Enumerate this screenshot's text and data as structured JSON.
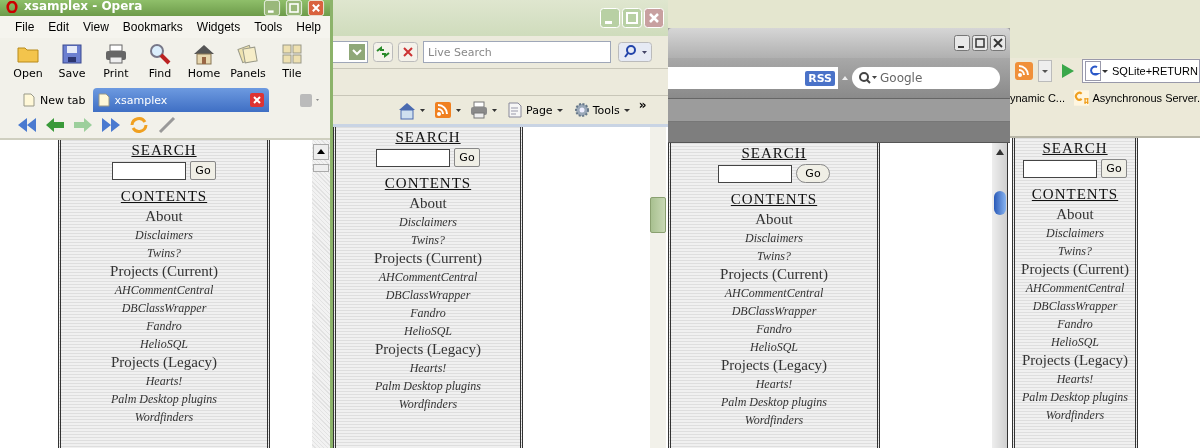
{
  "windows": [
    {
      "kind": "opera",
      "title": "xsamplex - Opera",
      "menu": [
        "File",
        "Edit",
        "View",
        "Bookmarks",
        "Widgets",
        "Tools",
        "Help"
      ],
      "toolbar": [
        {
          "label": "Open"
        },
        {
          "label": "Save"
        },
        {
          "label": "Print"
        },
        {
          "label": "Find"
        },
        {
          "label": "Home"
        },
        {
          "label": "Panels"
        },
        {
          "label": "Tile"
        }
      ],
      "tabs": [
        {
          "label": "New tab",
          "selected": false
        },
        {
          "label": "xsamplex",
          "selected": true
        }
      ],
      "page": {
        "search_heading": "SEARCH",
        "go": "Go",
        "contents_heading": "CONTENTS",
        "items": [
          {
            "text": "About",
            "kind": "heading"
          },
          {
            "text": "Disclaimers",
            "kind": "link"
          },
          {
            "text": "Twins?",
            "kind": "link"
          },
          {
            "text": "Projects (Current)",
            "kind": "heading"
          },
          {
            "text": "AHCommentCentral",
            "kind": "link"
          },
          {
            "text": "DBClassWrapper",
            "kind": "link"
          },
          {
            "text": "Fandro",
            "kind": "link"
          },
          {
            "text": "HelioSQL",
            "kind": "link"
          },
          {
            "text": "Projects (Legacy)",
            "kind": "heading"
          },
          {
            "text": "Hearts!",
            "kind": "link"
          },
          {
            "text": "Palm Desktop plugins",
            "kind": "link"
          },
          {
            "text": "Wordfinders",
            "kind": "link"
          }
        ]
      }
    },
    {
      "kind": "ie",
      "search_placeholder": "Live Search",
      "commands": [
        {
          "label": "Page"
        },
        {
          "label": "Tools"
        }
      ],
      "overflow": "»",
      "page": {
        "search_heading": "SEARCH",
        "go": "Go",
        "contents_heading": "CONTENTS",
        "items": [
          {
            "text": "About",
            "kind": "heading"
          },
          {
            "text": "Disclaimers",
            "kind": "link"
          },
          {
            "text": "Twins?",
            "kind": "link"
          },
          {
            "text": "Projects (Current)",
            "kind": "heading"
          },
          {
            "text": "AHCommentCentral",
            "kind": "link"
          },
          {
            "text": "DBClassWrapper",
            "kind": "link"
          },
          {
            "text": "Fandro",
            "kind": "link"
          },
          {
            "text": "HelioSQL",
            "kind": "link"
          },
          {
            "text": "Projects (Legacy)",
            "kind": "heading"
          },
          {
            "text": "Hearts!",
            "kind": "link"
          },
          {
            "text": "Palm Desktop plugins",
            "kind": "link"
          },
          {
            "text": "Wordfinders",
            "kind": "link"
          }
        ]
      }
    },
    {
      "kind": "safari",
      "rss": "RSS",
      "search_placeholder": "Google",
      "page": {
        "search_heading": "SEARCH",
        "go": "Go",
        "contents_heading": "CONTENTS",
        "items": [
          {
            "text": "About",
            "kind": "heading"
          },
          {
            "text": "Disclaimers",
            "kind": "link"
          },
          {
            "text": "Twins?",
            "kind": "link"
          },
          {
            "text": "Projects (Current)",
            "kind": "heading"
          },
          {
            "text": "AHCommentCentral",
            "kind": "link"
          },
          {
            "text": "DBClassWrapper",
            "kind": "link"
          },
          {
            "text": "Fandro",
            "kind": "link"
          },
          {
            "text": "HelioSQL",
            "kind": "link"
          },
          {
            "text": "Projects (Legacy)",
            "kind": "heading"
          },
          {
            "text": "Hearts!",
            "kind": "link"
          },
          {
            "text": "Palm Desktop plugins",
            "kind": "link"
          },
          {
            "text": "Wordfinders",
            "kind": "link"
          }
        ]
      }
    },
    {
      "kind": "firefox",
      "search_value": "SQLite+RETURN",
      "bookmarks": [
        "ynamic C...",
        "Asynchronous Server."
      ],
      "page": {
        "search_heading": "SEARCH",
        "go": "Go",
        "contents_heading": "CONTENTS",
        "items": [
          {
            "text": "About",
            "kind": "heading"
          },
          {
            "text": "Disclaimers",
            "kind": "link"
          },
          {
            "text": "Twins?",
            "kind": "link"
          },
          {
            "text": "Projects (Current)",
            "kind": "heading"
          },
          {
            "text": "AHCommentCentral",
            "kind": "link"
          },
          {
            "text": "DBClassWrapper",
            "kind": "link"
          },
          {
            "text": "Fandro",
            "kind": "link"
          },
          {
            "text": "HelioSQL",
            "kind": "link"
          },
          {
            "text": "Projects (Legacy)",
            "kind": "heading"
          },
          {
            "text": "Hearts!",
            "kind": "link"
          },
          {
            "text": "Palm Desktop plugins",
            "kind": "link"
          },
          {
            "text": "Wordfinders",
            "kind": "link"
          }
        ]
      }
    }
  ]
}
